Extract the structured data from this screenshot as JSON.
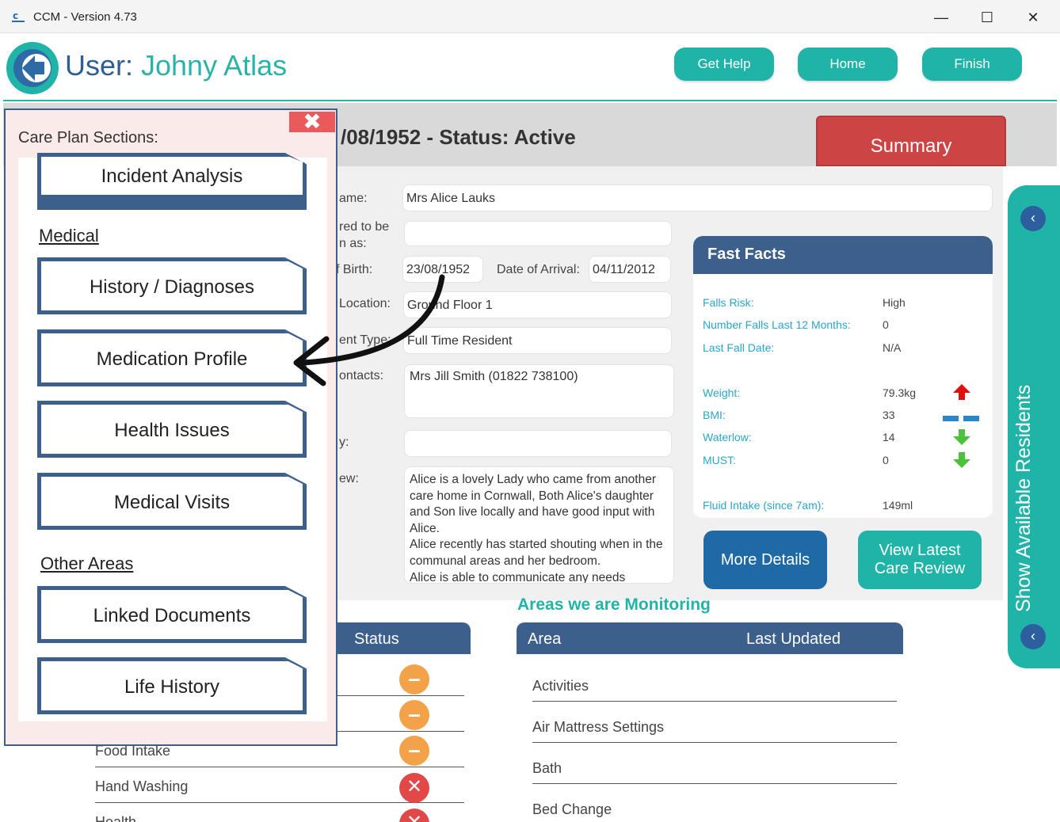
{
  "window": {
    "title": "CCM - Version 4.73",
    "minimize": "—",
    "maximize": "☐",
    "close": "✕"
  },
  "header": {
    "user_label": "User: ",
    "user_name": "Johny Atlas",
    "buttons": [
      "Get Help",
      "Home",
      "Finish"
    ]
  },
  "status": {
    "text": "/08/1952 - Status: Active",
    "summary_label": "Summary"
  },
  "form": {
    "labels": [
      "ame:",
      "red to be",
      "n as:",
      "f Birth:",
      "Location:",
      "ent Type:",
      "ontacts:",
      "y:",
      "ew:"
    ],
    "name": "Mrs Alice Lauks",
    "preferred": "",
    "dob": "23/08/1952",
    "arrival_label": "Date of Arrival:",
    "arrival": "04/11/2012",
    "location": "Ground Floor 1",
    "resident_type": "Full Time Resident",
    "contacts": "Mrs Jill Smith (01822 738100)",
    "history": "",
    "overview": "Alice is a lovely Lady who came from another care home in Cornwall, Both Alice's daughter and Son live locally and have good input with Alice.\nAlice recently has started shouting when in the communal areas and her bedroom.\nAlice is able to communicate any needs"
  },
  "fast_facts": {
    "title": "Fast Facts",
    "rows": [
      {
        "label": "Falls Risk:",
        "value": "High"
      },
      {
        "label": "Number Falls Last 12 Months:",
        "value": "0"
      },
      {
        "label": "Last Fall Date:",
        "value": "N/A"
      },
      {
        "label": "Weight:",
        "value": "79.3kg",
        "trend": "up"
      },
      {
        "label": "BMI:",
        "value": "33",
        "trend": "same"
      },
      {
        "label": "Waterlow:",
        "value": "14",
        "trend": "down"
      },
      {
        "label": "MUST:",
        "value": "0",
        "trend": "down"
      },
      {
        "label": "Fluid Intake (since 7am):",
        "value": "149ml"
      }
    ],
    "colors": {
      "up": "#e01010",
      "down": "#4cc23c",
      "same": "#2a86c9"
    }
  },
  "buttons": {
    "more_details": "More Details",
    "care_review": "View Latest Care Review"
  },
  "residents_panel": {
    "label": "Show Available Residents",
    "top_icon": "chevron-left-icon",
    "bottom_icon": "chevron-left-icon"
  },
  "monitoring": {
    "title": "Areas we are Monitoring",
    "columns": [
      "Area",
      "Last Updated"
    ],
    "rows": [
      "Activities",
      "Air Mattress Settings",
      "Bath",
      "Bed Change"
    ]
  },
  "status_table": {
    "column": "Status",
    "rows": [
      {
        "label": "",
        "status": "minus"
      },
      {
        "label": "",
        "status": "minus"
      },
      {
        "label": "Food Intake",
        "status": "minus"
      },
      {
        "label": "Hand Washing",
        "status": "cross"
      },
      {
        "label": "Health...",
        "status": "cross"
      }
    ]
  },
  "care_plan": {
    "title": "Care Plan Sections:",
    "close": "✖",
    "items": [
      {
        "type": "button",
        "label": "Incident Analysis"
      },
      {
        "type": "heading",
        "label": "Medical"
      },
      {
        "type": "button",
        "label": "History / Diagnoses"
      },
      {
        "type": "button",
        "label": "Medication Profile"
      },
      {
        "type": "button",
        "label": "Health Issues"
      },
      {
        "type": "button",
        "label": "Medical Visits"
      },
      {
        "type": "heading",
        "label": "Other Areas"
      },
      {
        "type": "button",
        "label": "Linked Documents"
      },
      {
        "type": "button",
        "label": "Life History"
      }
    ]
  }
}
